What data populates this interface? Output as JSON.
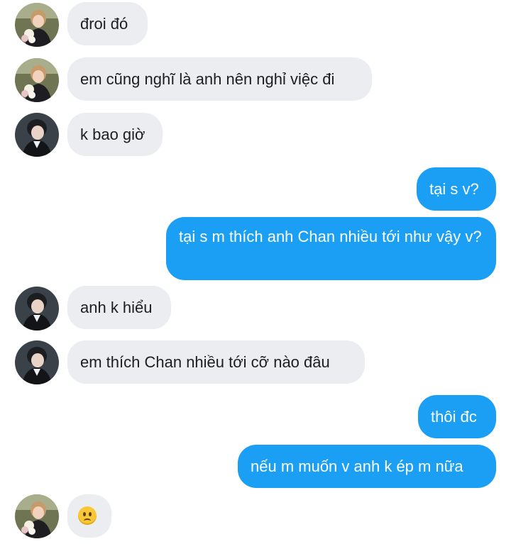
{
  "colors": {
    "incoming_bubble": "#ebedf0",
    "outgoing_bubble": "#1a9ff4",
    "incoming_text": "#1c1e21",
    "outgoing_text": "#ffffff"
  },
  "messages": [
    {
      "direction": "incoming",
      "sender": "girl",
      "text": "đroi đó"
    },
    {
      "direction": "incoming",
      "sender": "girl",
      "text": "em cũng nghĩ là anh nên nghỉ việc đi"
    },
    {
      "direction": "incoming",
      "sender": "boy",
      "text": "k bao giờ"
    },
    {
      "direction": "outgoing",
      "text": "tại s v?"
    },
    {
      "direction": "outgoing",
      "text": "tại s m thích anh Chan nhiều tới như vậy v?"
    },
    {
      "direction": "incoming",
      "sender": "boy",
      "text": "anh k hiểu"
    },
    {
      "direction": "incoming",
      "sender": "boy",
      "text": "em thích Chan nhiều tới cỡ nào đâu"
    },
    {
      "direction": "outgoing",
      "text": "thôi đc"
    },
    {
      "direction": "outgoing",
      "text": "nếu m muốn v anh k ép m nữa"
    },
    {
      "direction": "incoming",
      "sender": "girl",
      "emoji": "slightly-frowning-face-emoji"
    }
  ]
}
